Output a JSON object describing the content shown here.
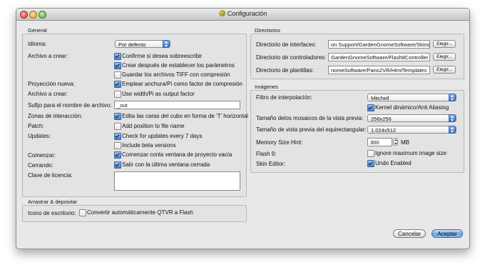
{
  "window": {
    "title": "Configuración"
  },
  "general": {
    "title": "General",
    "idioma_label": "Idioma:",
    "idioma_value": "Por defecto",
    "archivo_crear_label": "Archivo a crear:",
    "confirm_overwrite": "Confirme si desea sobreescribir",
    "create_after_params": "Crear después de establecer los parámetros",
    "save_tiff": "Guardar los archivos TIFF con compresión",
    "proyeccion_label": "Proyección nueva:",
    "use_width_factor": "Emplear anchura/Pi como factor de compresión",
    "archivo_crear_label2": "Archivo a crear:",
    "use_width_output": "Use width/Pi as output factor",
    "sufijo_label": "Sufijo para el nombre de archivo:",
    "sufijo_value": "_out",
    "zonas_label": "Zonas de interacción:",
    "edit_faces": "Edita las caras del cubo en forma de 'T' horizontal",
    "patch_label": "Patch:",
    "add_position": "Add position to file name",
    "updates_label": "Updates:",
    "check_updates": "Check for updates every 7 days",
    "include_beta": "Include beta versions",
    "comenzar_label": "Comenzar:",
    "start_new_window": "Comenzar conla  ventana de proyecto vacía",
    "cerrando_label": "Cerrando:",
    "exit_last_window": "Salir con la última ventana cerrada",
    "licencia_label": "Clave de licencia:",
    "licencia_value": ""
  },
  "dragdrop": {
    "title": "Arrastrar & depositar",
    "icono_label": "Icono de escritorio:",
    "convert_qtvr": "Convertir automáticamente QTVR a Flash"
  },
  "directorios": {
    "title": "Directorios",
    "rows": [
      {
        "label": "Directorio de interfaces:",
        "value": "on Support/GardenGnomeSoftware/Skins",
        "button": "Elegir..."
      },
      {
        "label": "Directorio de controladores:",
        "value": "GardenGnomeSoftware/Flash8Controller",
        "button": "Elegir..."
      },
      {
        "label": "Directorio de plantillas:",
        "value": "nomeSoftware/Pano2VR/HtmlTemplates",
        "button": "Elegir..."
      }
    ]
  },
  "imagenes": {
    "title": "Imágenes",
    "filtro_label": "Filtro de interpolación:",
    "filtro_value": "Mitchell",
    "kernel_label": "Kernel dinámico/Anti Aliasing",
    "tamano_mosaicos_label": "Tamaño delos mosaicos de la vista previa:",
    "tamano_mosaicos_value": "256x256",
    "tamano_equirect_label": "Tamaño de vista previa del equirectangular:",
    "tamano_equirect_value": "1.024x512",
    "memory_label": "Memory Size Hint:",
    "memory_value": "300",
    "memory_unit": "MB",
    "flash9_label": "Flash 9:",
    "ignore_max": "Ignore maximum image size",
    "skin_label": "Skin Editor:",
    "undo_enabled": "Undo Enabled"
  },
  "footer": {
    "cancel": "Cancelar",
    "accept": "Aceptar"
  }
}
